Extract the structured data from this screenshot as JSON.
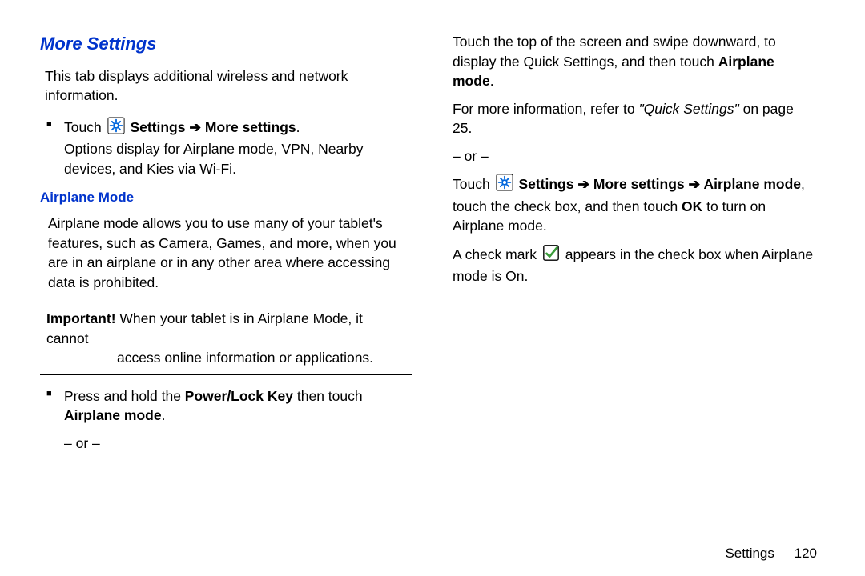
{
  "left": {
    "title": "More Settings",
    "intro": "This tab displays additional wireless and network information.",
    "touch_prefix": "Touch ",
    "settings_label": "Settings",
    "more_settings_label": "More settings",
    "options_line": "Options display for Airplane mode, VPN, Nearby devices, and Kies via Wi-Fi.",
    "airplane_heading": "Airplane Mode",
    "airplane_para": "Airplane mode allows you to use many of your tablet's features, such as Camera, Games, and more, when you are in an airplane or in any other area where accessing data is prohibited.",
    "important_label": "Important!",
    "important_text_first": " When your tablet is in Airplane Mode, it cannot",
    "important_text_cont": "access online information or applications.",
    "press_hold_prefix": "Press and hold the ",
    "power_lock": "Power/Lock Key",
    "press_hold_mid": " then touch ",
    "airplane_mode_label": "Airplane mode",
    "or": "– or –"
  },
  "right": {
    "swipe_para_1": "Touch the top of the screen and swipe downward, to display the Quick Settings, and then touch ",
    "airplane_mode_bold": "Airplane mode",
    "more_info_prefix": "For more information, refer to ",
    "quick_settings_quote": "\"Quick Settings\"",
    "more_info_suffix": " on page 25.",
    "or": "– or –",
    "touch_settings_prefix": "Touch ",
    "settings_label": "Settings",
    "more_settings_label": "More settings",
    "airplane_mode_label": "Airplane mode",
    "touch_check_1": ", touch the check box, and then touch ",
    "ok_label": "OK",
    "touch_check_2": " to turn on Airplane mode.",
    "checkmark_prefix": "A check mark ",
    "checkmark_suffix": " appears in the check box when Airplane mode is On."
  },
  "footer": {
    "section": "Settings",
    "page": "120"
  }
}
